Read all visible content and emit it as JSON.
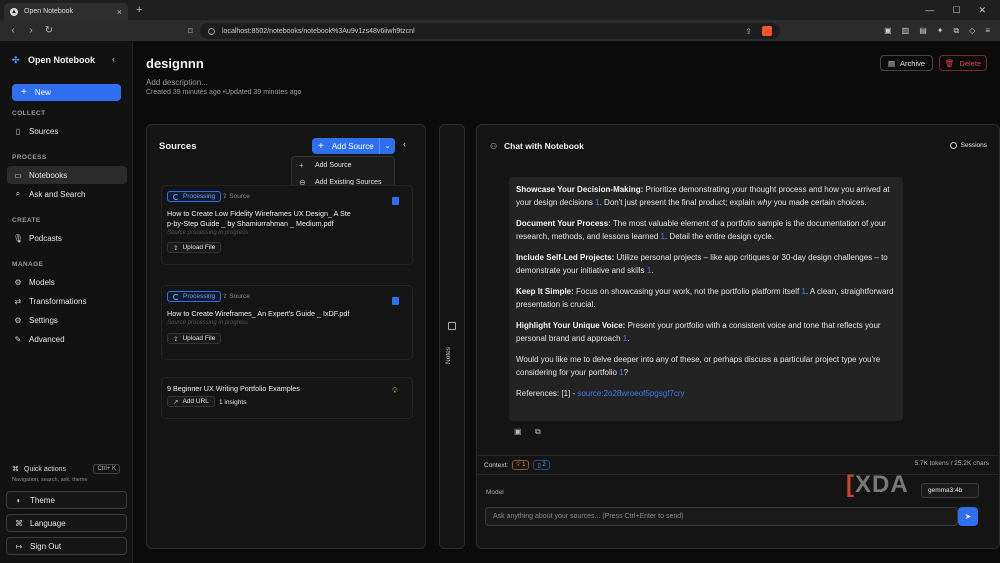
{
  "browser": {
    "tab_title": "Open Notebook",
    "url": "localhost:8502/notebooks/notebook%3Au9v1zs48v6iiwh9tzcnl"
  },
  "sidebar": {
    "brand": "Open Notebook",
    "new_label": "New",
    "sections": {
      "collect": "COLLECT",
      "process": "PROCESS",
      "create": "CREATE",
      "manage": "MANAGE"
    },
    "items": {
      "sources": "Sources",
      "notebooks": "Notebooks",
      "ask": "Ask and Search",
      "podcasts": "Podcasts",
      "models": "Models",
      "transformations": "Transformations",
      "settings": "Settings",
      "advanced": "Advanced"
    },
    "quick_actions": "Quick actions",
    "quick_shortcut": "Ctrl+ K",
    "quick_desc": "Navigation, search, ask, theme",
    "theme": "Theme",
    "language": "Language",
    "signout": "Sign Out"
  },
  "notebook": {
    "title": "designnn",
    "description_placeholder": "Add description...",
    "meta": "Created 39 minutes ago •Updated 39 minutes ago",
    "archive": "Archive",
    "delete": "Delete"
  },
  "sources": {
    "title": "Sources",
    "add_source": "Add Source",
    "menu": [
      "Add Source",
      "Add Existing Sources"
    ],
    "cards": [
      {
        "status": "Processing",
        "tag": "Source",
        "title_line1": "How to Create Low Fidelity Wireframes UX Design_ A Ste",
        "title_line2": "p-by-Step Guide _ by Shamiurrahman _ Medium.pdf",
        "progress": "Source processing in progress",
        "action": "Upload File"
      },
      {
        "status": "Processing",
        "tag": "Source",
        "title_line1": "How to Create Wireframes_ An Expert's Guide _ IxDF.pdf",
        "progress": "Source processing in progress",
        "action": "Upload File"
      },
      {
        "title_line1": "9 Beginner UX Writing Portfolio Examples",
        "action": "Add URL",
        "insights": "1 insights"
      }
    ]
  },
  "notes": {
    "label": "Notes"
  },
  "chat": {
    "title": "Chat with Notebook",
    "sessions": "Sessions",
    "p1_head": "Showcase Your Decision-Making:",
    "p1_a": " Prioritize demonstrating your thought process and how you arrived at your design decisions ",
    "p1_cite": "1",
    "p1_b": ". Don't just present the final product; explain ",
    "p1_em": "why",
    "p1_c": " you made certain choices.",
    "p2_head": "Document Your Process:",
    "p2_a": " The most valuable element of a portfolio sample is the documentation of your research, methods, and lessons learned ",
    "p2_cite": "1",
    "p2_b": ". Detail the entire design cycle.",
    "p3_head": "Include Self-Led Projects:",
    "p3_a": " Utilize personal projects – like app critiques or 30-day design challenges – to demonstrate your initiative and skills ",
    "p3_cite": "1",
    "p3_b": ".",
    "p4_head": "Keep It Simple:",
    "p4_a": " Focus on showcasing your work, not the portfolio platform itself ",
    "p4_cite": "1",
    "p4_b": ". A clean, straightforward presentation is crucial.",
    "p5_head": "Highlight Your Unique Voice:",
    "p5_a": " Present your portfolio with a consistent voice and tone that reflects your personal brand and approach ",
    "p5_cite": "1",
    "p5_b": ".",
    "p6_a": "Would you like me to delve deeper into any of these, or perhaps discuss a particular project type you're considering for your portfolio ",
    "p6_cite": "1",
    "p6_b": "?",
    "ref_label": "References: [1] - ",
    "ref_link": "source:2o28wroeof5pgsgf7cry",
    "context_label": "Context:",
    "ctx_insights": "1",
    "ctx_sources": "2",
    "tokens": "5.7K tokens  /  25.2K chars",
    "model_label": "Model",
    "model_value": "gemma3:4b",
    "input_placeholder": "Ask anything about your sources... (Press Ctrl+Enter to send)"
  },
  "watermark": "XDA",
  "colors": {
    "accent": "#2f6fed",
    "danger": "#e04545",
    "insight": "#d9a23a"
  }
}
